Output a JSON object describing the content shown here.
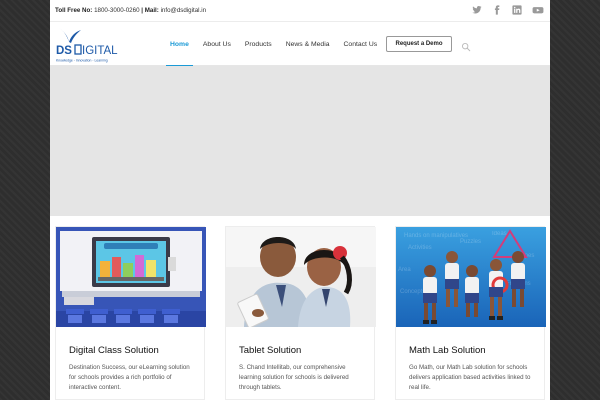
{
  "topbar": {
    "toll_free_label": "Toll Free No:",
    "toll_free_number": "1800-3000-0260",
    "separator": "|",
    "mail_label": "Mail:",
    "mail_value": "info@dsdigital.in",
    "social_icons": [
      "twitter-icon",
      "facebook-icon",
      "linkedin-icon",
      "youtube-icon"
    ]
  },
  "logo": {
    "brand": "DS DIGITAL",
    "tagline": "Knowledge - Innovation - Learning"
  },
  "nav": {
    "items": [
      "Home",
      "About Us",
      "Products",
      "News & Media",
      "Contact Us"
    ],
    "active": "Home",
    "demo_button": "Request a Demo",
    "search_icon": "search-icon"
  },
  "cards": [
    {
      "title": "Digital Class Solution",
      "description": "Destination Success, our eLearning solution for schools provides a rich portfolio of interactive content."
    },
    {
      "title": "Tablet Solution",
      "description": "S. Chand Intellitab, our comprehensive learning solution for schools is delivered through tablets."
    },
    {
      "title": "Math Lab Solution",
      "description": "Go Math, our Math Lab solution for schools delivers application based activities linked to real life."
    }
  ],
  "colors": {
    "accent": "#1b9ad6",
    "logo_blue": "#1e5aa8",
    "page_bg": "#2e2e2e",
    "banner_bg": "#e5e5e5"
  }
}
